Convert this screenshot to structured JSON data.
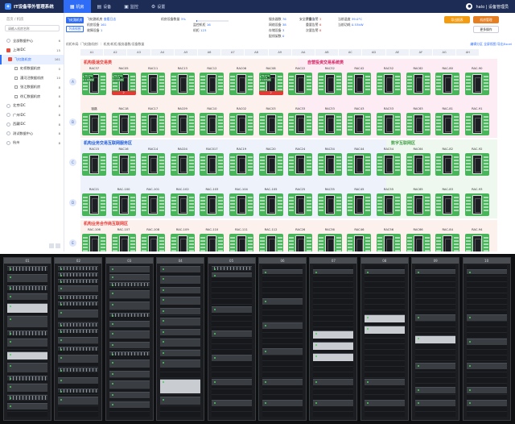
{
  "app": {
    "title": "IT设备带外管理系统",
    "nav": [
      {
        "label": "机房",
        "icon": "building-icon",
        "active": true
      },
      {
        "label": "设备",
        "icon": "server-icon",
        "active": false
      },
      {
        "label": "监控",
        "icon": "monitor-icon",
        "active": false
      },
      {
        "label": "设置",
        "icon": "gear-icon",
        "active": false
      }
    ],
    "user": "halo | 设备管理员"
  },
  "sidebar": {
    "breadcrumb": "首页 / 机房",
    "search_placeholder": "请输入机房名称",
    "items": [
      {
        "label": "全部数据中心",
        "count": "6"
      },
      {
        "label": "上海IDC",
        "count": "15"
      },
      {
        "label": "飞虹路机房",
        "count": "161"
      },
      {
        "label": "虹桥数据机房",
        "count": "0"
      },
      {
        "label": "漕河泾数据机房",
        "count": "10"
      },
      {
        "label": "张江数据机房",
        "count": "8"
      },
      {
        "label": "徐汇数据机房",
        "count": "8"
      },
      {
        "label": "北京IDC",
        "count": "8"
      },
      {
        "label": "广州IDC",
        "count": "8"
      },
      {
        "label": "西藏IDC",
        "count": "8"
      },
      {
        "label": "测试数据中心",
        "count": "8"
      },
      {
        "label": "杭州",
        "count": "8"
      }
    ]
  },
  "main": {
    "btn_primary": "飞虹路机房",
    "btn_secondary": "列表视图",
    "stats": [
      {
        "k": "飞虹路机房",
        "v": "查看日志"
      },
      {
        "k": "机房设备",
        "v": "161"
      },
      {
        "k": "故障设备",
        "v": "1"
      },
      {
        "k": "机房设备数量",
        "v": "3%"
      },
      {
        "k": "监控机柜",
        "v": "16"
      },
      {
        "k": "机柜",
        "v": "123"
      },
      {
        "k": "服务器数",
        "v": "76"
      },
      {
        "k": "网络设备",
        "v": "38"
      },
      {
        "k": "存储设备",
        "v": "3"
      },
      {
        "k": "安全设备",
        "v": "2"
      },
      {
        "k": "配线架数",
        "v": "0"
      },
      {
        "k": "严重告警",
        "v": "3"
      },
      {
        "k": "重要告警",
        "v": "6"
      },
      {
        "k": "次要告警",
        "v": "8"
      },
      {
        "k": "当前温度",
        "v": "39.0°C"
      },
      {
        "k": "当前功耗",
        "v": "0.53kW"
      }
    ],
    "capacity_pct": 3,
    "btn_export": "导出报表",
    "btn_manage": "机房管理",
    "btn_more": "更多操作",
    "path_line": "机柜布局（飞虹路机房）：机房/机柜/服务器数/设备数量",
    "help": "编辑分区  全屏视图  导出Excel",
    "cols": [
      "A1",
      "A2",
      "A3",
      "A4",
      "A5",
      "A6",
      "A7",
      "A8",
      "A9",
      "AA",
      "AB",
      "AC",
      "AD",
      "AE",
      "AF",
      "AG",
      "AH"
    ],
    "rows": [
      "A",
      "B",
      "C",
      "D",
      "E"
    ],
    "zones": [
      {
        "label": "机构极速交易类",
        "color": "#e53935"
      },
      {
        "label": "自营投资交易系统类",
        "color": "#d81b60"
      },
      {
        "label": "机构业务交易互联网服务区",
        "color": "#1e5bd8"
      },
      {
        "label": "数字互联网区",
        "color": "#43a047"
      },
      {
        "label": "机构业务合作商互联网区",
        "color": "#e53935"
      }
    ],
    "racks": [
      [
        "RAC37",
        "RAC05",
        "RAC11",
        "RAC13",
        "RAC12",
        "RAC06",
        "RAC08",
        "RAC22",
        "RAC32",
        "RAC42",
        "RAC52",
        "RAC62",
        "RAC-80",
        "RAC-90"
      ],
      [
        "链路",
        "RAC18",
        "RAC17",
        "RAC09",
        "RAC10",
        "RAC02",
        "RAC03",
        "RAC33",
        "RAC33",
        "RAC43",
        "RAC53",
        "RAC63",
        "RAC-81",
        "RAC-91"
      ],
      [
        "RAC15",
        "RAC16",
        "RAC14",
        "RAC04",
        "RAC017",
        "RAC19",
        "RAC20",
        "RAC24",
        "RAC34",
        "RAC44",
        "RAC54",
        "RAC64",
        "RAC-82",
        "RAC-92"
      ],
      [
        "RAC21",
        "RAC-100",
        "RAC-101",
        "RAC-102",
        "RAC-103",
        "RAC-104",
        "RAC-105",
        "RAC25",
        "RAC35",
        "RAC45",
        "RAC55",
        "RAC65",
        "RAC-83",
        "RAC-93"
      ],
      [
        "RAC-106",
        "RAC-107",
        "RAC-108",
        "RAC-109",
        "RAC-110",
        "RAC-111",
        "RAC-112",
        "RAC26",
        "RAC36",
        "RAC46",
        "RAC56",
        "RAC66",
        "RAC-84",
        "RAC-94"
      ]
    ],
    "badges": [
      {
        "r": 0,
        "c": 0,
        "t1": "39.0°C",
        "t2": "0.63kW"
      },
      {
        "r": 0,
        "c": 1,
        "t1": "39.0°C",
        "t2": "0.63kW",
        "bar": "2"
      },
      {
        "r": 0,
        "c": 6,
        "t1": "39.0°C",
        "t2": "0.63kW",
        "bar": "2"
      }
    ]
  },
  "photo": {
    "cabinets": [
      "01",
      "02",
      "03",
      "04",
      "05",
      "06",
      "07",
      "08",
      "09",
      "10"
    ]
  }
}
